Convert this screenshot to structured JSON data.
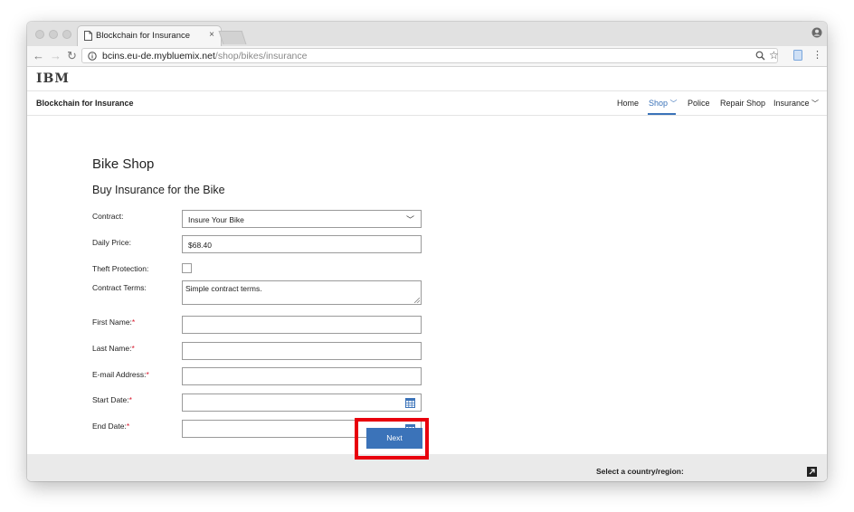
{
  "browser": {
    "tab_title": "Blockchain for Insurance",
    "url_host": "bcins.eu-de.mybluemix.net",
    "url_path": "/shop/bikes/insurance"
  },
  "header": {
    "logo": "IBM",
    "app_title": "Blockchain for Insurance",
    "nav": [
      "Home",
      "Shop",
      "Police",
      "Repair Shop",
      "Insurance"
    ]
  },
  "main": {
    "title": "Bike Shop",
    "subtitle": "Buy Insurance for the Bike",
    "contract_label": "Contract:",
    "contract_value": "Insure Your Bike",
    "price_label": "Daily Price:",
    "price_value": "$68.40",
    "theft_label": "Theft Protection:",
    "theft_checked": false,
    "terms_label": "Contract Terms:",
    "terms_value": "Simple contract terms.",
    "first_name_label": "First Name:",
    "last_name_label": "Last Name:",
    "email_label": "E-mail Address:",
    "start_date_label": "Start Date:",
    "end_date_label": "End Date:",
    "required_mark": "*",
    "next_button": "Next"
  },
  "footer": {
    "country_label": "Select a country/region:"
  },
  "colors": {
    "accent": "#3b73b9",
    "required": "#d9182d",
    "highlight": "#e8000d"
  }
}
